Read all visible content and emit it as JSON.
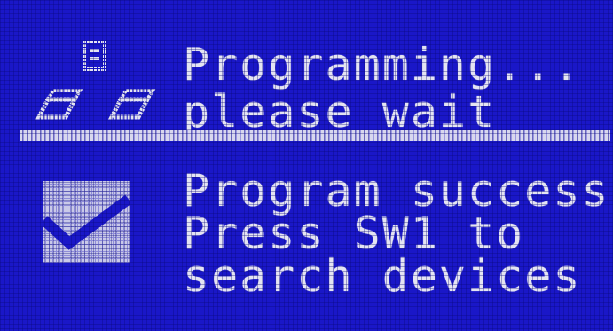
{
  "display": {
    "background_color": "#1a17c8",
    "text_color": "#e4e4f2"
  },
  "programming": {
    "icon": "network-devices-icon",
    "line1": "Programming...",
    "line2": "please wait"
  },
  "result": {
    "icon": "checkbox-checked-icon",
    "line1": "Program success",
    "line2": "Press SW1 to",
    "line3": "search devices"
  }
}
